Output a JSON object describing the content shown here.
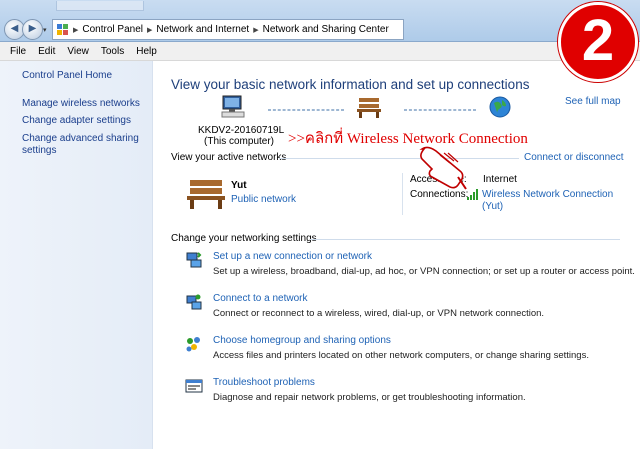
{
  "badge": "2",
  "breadcrumb": [
    "Control Panel",
    "Network and Internet",
    "Network and Sharing Center"
  ],
  "menu": [
    "File",
    "Edit",
    "View",
    "Tools",
    "Help"
  ],
  "sidebar": {
    "items": [
      {
        "label": "Control Panel Home"
      },
      {
        "label": "Manage wireless networks"
      },
      {
        "label": "Change adapter settings"
      },
      {
        "label": "Change advanced sharing settings"
      }
    ]
  },
  "main": {
    "heading": "View your basic network information and set up connections",
    "see_full_map": "See full map",
    "computer_name": "KKDV2-20160719L",
    "computer_note": "(This computer)",
    "annotation": ">>คลิกที่ Wireless Network Connection",
    "active_networks_title": "View your active networks",
    "connect_disconnect": "Connect or disconnect",
    "network_name": "Yut",
    "network_type": "Public network",
    "access_type_label": "Access type:",
    "access_type_value": "Internet",
    "connections_label": "Connections:",
    "connection_name": "Wireless Network Connection",
    "connection_ssid": "(Yut)",
    "change_settings_title": "Change your networking settings",
    "tasks": [
      {
        "title": "Set up a new connection or network",
        "desc": "Set up a wireless, broadband, dial-up, ad hoc, or VPN connection; or set up a router or access point.",
        "icon": "new-connection-icon"
      },
      {
        "title": "Connect to a network",
        "desc": "Connect or reconnect to a wireless, wired, dial-up, or VPN network connection.",
        "icon": "connect-network-icon"
      },
      {
        "title": "Choose homegroup and sharing options",
        "desc": "Access files and printers located on other network computers, or change sharing settings.",
        "icon": "homegroup-icon"
      },
      {
        "title": "Troubleshoot problems",
        "desc": "Diagnose and repair network problems, or get troubleshooting information.",
        "icon": "troubleshoot-icon"
      }
    ]
  },
  "colors": {
    "link": "#1e62b5",
    "heading": "#1e3f7a",
    "badge": "#e00000",
    "annotation": "#e00000"
  }
}
